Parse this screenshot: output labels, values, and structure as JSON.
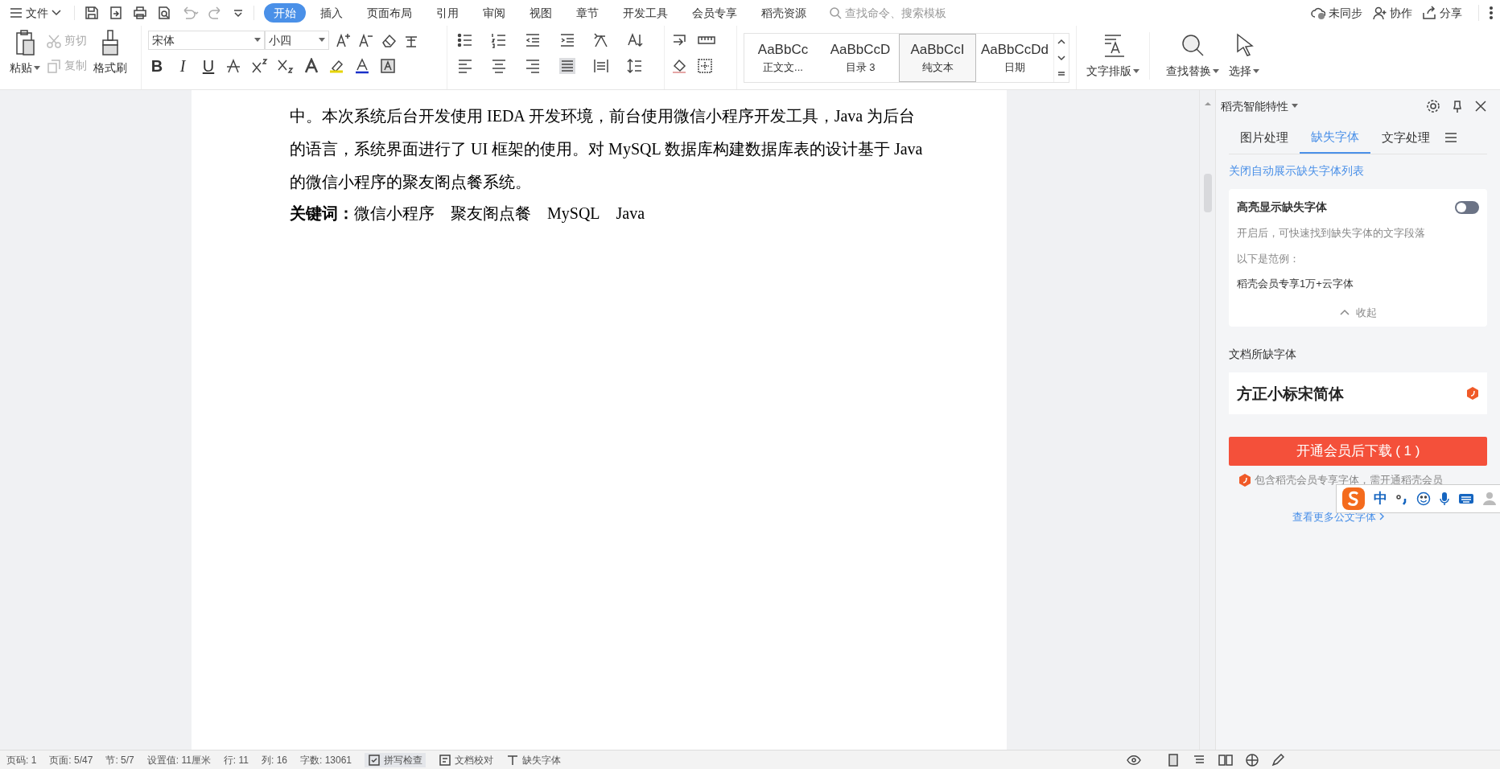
{
  "menu": {
    "file_label": "文件"
  },
  "tabs": [
    {
      "label": "开始",
      "selected": true
    },
    {
      "label": "插入",
      "selected": false
    },
    {
      "label": "页面布局",
      "selected": false
    },
    {
      "label": "引用",
      "selected": false
    },
    {
      "label": "审阅",
      "selected": false
    },
    {
      "label": "视图",
      "selected": false
    },
    {
      "label": "章节",
      "selected": false
    },
    {
      "label": "开发工具",
      "selected": false
    },
    {
      "label": "会员专享",
      "selected": false
    },
    {
      "label": "稻壳资源",
      "selected": false
    }
  ],
  "search": {
    "placeholder": "查找命令、搜索模板"
  },
  "top_actions": [
    {
      "kind": "cloud",
      "label": "未同步"
    },
    {
      "kind": "person",
      "label": "协作"
    },
    {
      "kind": "share",
      "label": "分享"
    }
  ],
  "clipboard": {
    "paste": "粘贴",
    "cut": {
      "label": "剪切",
      "disabled": true
    },
    "copy": {
      "label": "复制",
      "disabled": true
    },
    "painter": "格式刷"
  },
  "font": {
    "family": "宋体",
    "size": "小四",
    "glyphs": [
      "B",
      "I",
      "U"
    ]
  },
  "styles": [
    {
      "sample": "AaBbCc",
      "label": "正文文...",
      "selected": false
    },
    {
      "sample": "AaBbCcD",
      "label": "目录 3",
      "selected": false
    },
    {
      "sample": "AaBbCcI",
      "label": "纯文本",
      "selected": true
    },
    {
      "sample": "AaBbCcDd",
      "label": "日期",
      "selected": false
    }
  ],
  "big_buttons": [
    {
      "kind": "layout",
      "label": "文字排版"
    },
    {
      "kind": "find",
      "label": "查找替换"
    },
    {
      "kind": "select",
      "label": "选择"
    }
  ],
  "document": {
    "lines": [
      "中。本次系统后台开发使用 IEDA 开发环境，前台使用微信小程序开发工具，Java 为后台",
      "的语言，系统界面进行了 UI 框架的使用。对 MySQL 数据库构建数据库表的设计基于 Java",
      "的微信小程序的聚友阁点餐系统。"
    ],
    "keywords_label": "关键词：",
    "keywords": [
      "微信小程序",
      "聚友阁点餐",
      "MySQL",
      "Java"
    ]
  },
  "panel": {
    "title": "稻壳智能特性",
    "tabs": [
      {
        "label": "图片处理",
        "selected": false
      },
      {
        "label": "缺失字体",
        "selected": true
      },
      {
        "label": "文字处理",
        "selected": false
      }
    ],
    "close_link": "关闭自动展示缺失字体列表",
    "highlight": {
      "title": "高亮显示缺失字体",
      "on": false,
      "description": "开启后，可快速找到缺失字体的文字段落",
      "example_label": "以下是范例：",
      "example": "稻壳会员专享1万+云字体",
      "collapse": "收起"
    },
    "missing_title": "文档所缺字体",
    "missing_fonts": [
      "方正小标宋简体"
    ],
    "download_button": "开通会员后下载 ( 1 )",
    "note": "包含稻壳会员专享字体，需开通稻壳会员",
    "more_link": "查看更多公文字体"
  },
  "ime": {
    "mode": "中"
  },
  "status_bar": [
    "页码: 1",
    "页面: 5/47",
    "节: 5/7",
    "设置值: 11厘米",
    "行: 11",
    "列: 16",
    "字数: 13061",
    "拼写检查",
    "文档校对",
    "缺失字体"
  ]
}
